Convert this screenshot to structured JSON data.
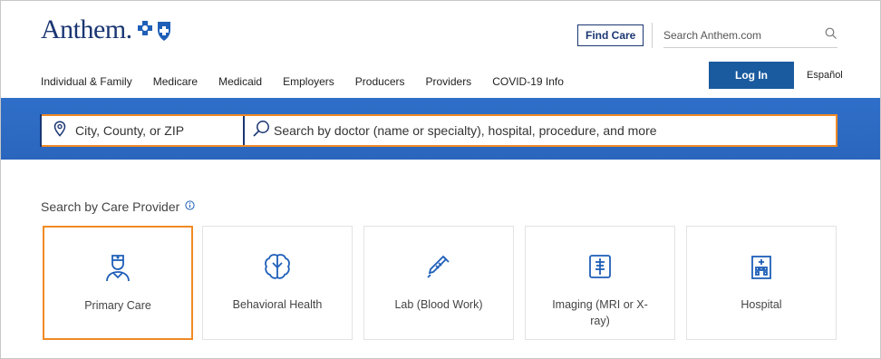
{
  "header": {
    "logo_text": "Anthem",
    "find_care_label": "Find Care",
    "search_placeholder": "Search Anthem.com",
    "login_label": "Log In",
    "espanol_label": "Español"
  },
  "nav": {
    "items": [
      "Individual & Family",
      "Medicare",
      "Medicaid",
      "Employers",
      "Producers",
      "Providers",
      "COVID-19 Info"
    ]
  },
  "care_search": {
    "location_placeholder": "City, County, or ZIP",
    "query_placeholder": "Search by doctor (name or specialty), hospital, procedure, and more"
  },
  "providers": {
    "title": "Search by Care Provider",
    "cards": [
      {
        "label": "Primary Care",
        "icon": "doctor-icon",
        "selected": true
      },
      {
        "label": "Behavioral Health",
        "icon": "brain-icon",
        "selected": false
      },
      {
        "label": "Lab (Blood Work)",
        "icon": "syringe-icon",
        "selected": false
      },
      {
        "label": "Imaging (MRI or X-ray)",
        "icon": "xray-icon",
        "selected": false
      },
      {
        "label": "Hospital",
        "icon": "hospital-icon",
        "selected": false
      }
    ]
  },
  "colors": {
    "brand_navy": "#1a3673",
    "band_blue": "#2f6fc9",
    "button_blue": "#1a5a9e",
    "icon_blue": "#1f5fb8",
    "highlight_orange": "#f08a24"
  }
}
